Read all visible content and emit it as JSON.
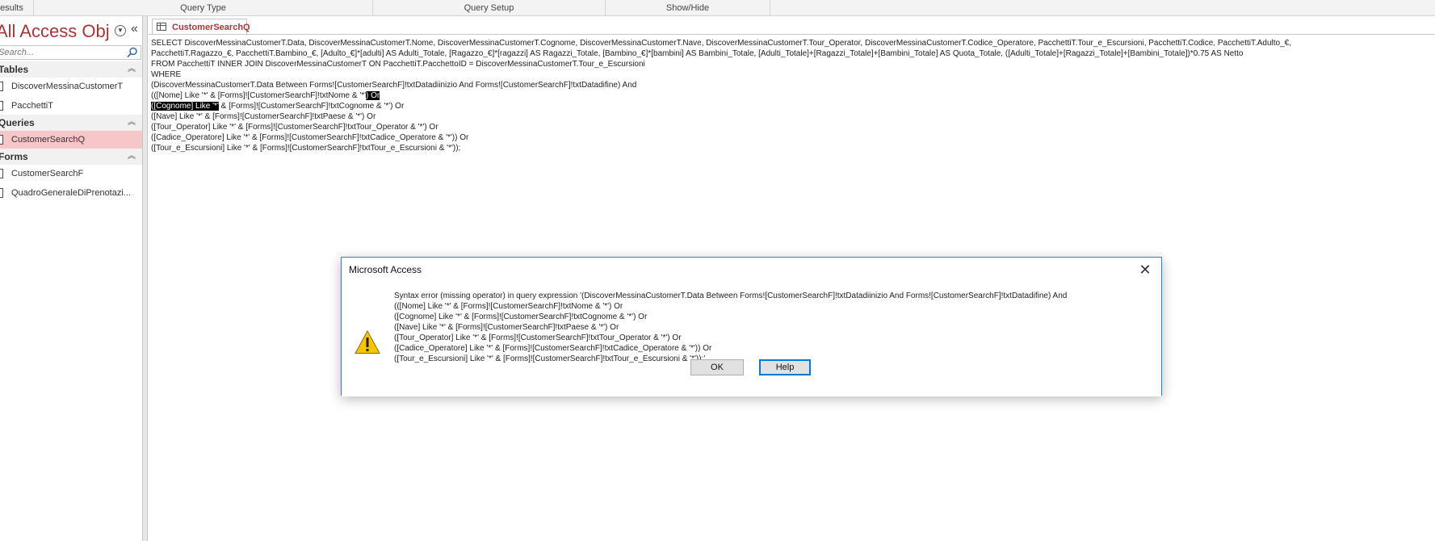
{
  "ribbon": {
    "groups": [
      "Results",
      "Query Type",
      "Query Setup",
      "Show/Hide"
    ]
  },
  "nav": {
    "title": "All Access Obje...",
    "search_placeholder": "Search...",
    "sections": [
      {
        "label": "Tables",
        "items": [
          "DiscoverMessinaCustomerT",
          "PacchettiT"
        ]
      },
      {
        "label": "Queries",
        "items": [
          "CustomerSearchQ"
        ]
      },
      {
        "label": "Forms",
        "items": [
          "CustomerSearchF",
          "QuadroGeneraleDiPrenotazi..."
        ]
      }
    ]
  },
  "document": {
    "tab_label": "CustomerSearchQ",
    "sql": {
      "l1": "SELECT DiscoverMessinaCustomerT.Data, DiscoverMessinaCustomerT.Nome, DiscoverMessinaCustomerT.Cognome, DiscoverMessinaCustomerT.Nave, DiscoverMessinaCustomerT.Tour_Operator, DiscoverMessinaCustomerT.Codice_Operatore, PacchettiT.Tour_e_Escursioni, PacchettiT.Codice, PacchettiT.Adulto_€,",
      "l2": "PacchettiT.Ragazzo_€, PacchettiT.Bambino_€, [Adulto_€]*[adulti] AS Adulti_Totale, [Ragazzo_€]*[ragazzi] AS Ragazzi_Totale, [Bambino_€]*[bambini] AS Bambini_Totale, [Adulti_Totale]+[Ragazzi_Totale]+[Bambini_Totale] AS Quota_Totale, ([Adulti_Totale]+[Ragazzi_Totale]+[Bambini_Totale])*0.75 AS Netto",
      "l3": "FROM PacchettiT INNER JOIN DiscoverMessinaCustomerT ON PacchettiT.PacchettoID = DiscoverMessinaCustomerT.Tour_e_Escursioni",
      "l4": "WHERE",
      "l5": "(DiscoverMessinaCustomerT.Data Between Forms![CustomerSearchF]!txtDatadiinizio And Forms![CustomerSearchF]!txtDatadifine) And",
      "l6a": "(([Nome] Like '*' & [Forms]![CustomerSearchF]!txtNome & '*'",
      "l6b": ") Or",
      "l7a": "([Cognome] Like '*'",
      "l7b": " & [Forms]![CustomerSearchF]!txtCognome & '*') Or",
      "l8": "([Nave] Like '*' & [Forms]![CustomerSearchF]!txtPaese & '*') Or",
      "l9": "([Tour_Operator] Like '*' & [Forms]![CustomerSearchF]!txtTour_Operator & '*') Or",
      "l10": "([Cadice_Operatore] Like '*' & [Forms]![CustomerSearchF]!txtCadice_Operatore & '*')) Or",
      "l11": "([Tour_e_Escursioni] Like '*' & [Forms]![CustomerSearchF]!txtTour_e_Escursioni & '*'));"
    }
  },
  "dialog": {
    "title": "Microsoft Access",
    "close_glyph": "✕",
    "message": {
      "m1": "Syntax error (missing operator) in query expression '(DiscoverMessinaCustomerT.Data Between Forms![CustomerSearchF]!txtDatadiinizio And Forms![CustomerSearchF]!txtDatadifine) And",
      "m2": "(([Nome] Like '*' & [Forms]![CustomerSearchF]!txtNome & '*') Or",
      "m3": "([Cognome] Like '*' & [Forms]![CustomerSearchF]!txtCognome & '*') Or",
      "m4": "([Nave] Like '*' & [Forms]![CustomerSearchF]!txtPaese & '*') Or",
      "m5": "([Tour_Operator] Like '*' & [Forms]![CustomerSearchF]!txtTour_Operator & '*') Or",
      "m6": "([Cadice_Operatore] Like '*' & [Forms]![CustomerSearchF]!txtCadice_Operatore & '*')) Or",
      "m7": "([Tour_e_Escursioni] Like '*' & [Forms]![CustomerSearchF]!txtTour_e_Escursioni & '*'));'."
    },
    "ok_label": "OK",
    "help_label": "Help"
  },
  "colors": {
    "accent": "#a4373a",
    "selected_item": "#f6c6c8",
    "warning": "#f7c600"
  }
}
